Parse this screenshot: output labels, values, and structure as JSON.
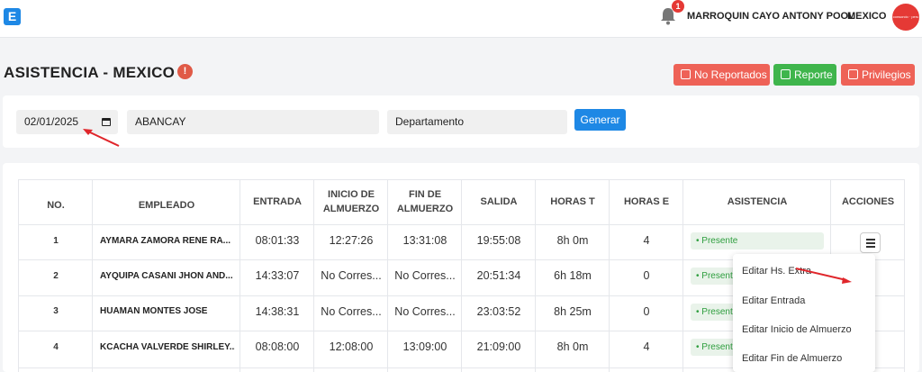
{
  "topbar": {
    "logo_letter": "E",
    "notification_count": "1",
    "user_name": "MARROQUIN CAYO ANTONY POOL",
    "country": "MEXICO",
    "avatar_text": "consorcio · peru"
  },
  "page": {
    "title": "ASISTENCIA - MEXICO",
    "info_icon": "!"
  },
  "actions": {
    "no_reportados": "No Reportados",
    "reporte": "Reporte",
    "privilegios": "Privilegios"
  },
  "filters": {
    "date_value": "02/01/2025",
    "city_value": "ABANCAY",
    "department_value": "Departamento",
    "generate_label": "Generar"
  },
  "table": {
    "headers": {
      "no": "NO.",
      "empleado": "EMPLEADO",
      "entrada": "ENTRADA",
      "inicio_1": "INICIO DE",
      "inicio_2": "ALMUERZO",
      "fin_1": "FIN DE",
      "fin_2": "ALMUERZO",
      "salida": "SALIDA",
      "horas_t": "HORAS T",
      "horas_e": "HORAS E",
      "asistencia": "ASISTENCIA",
      "acciones": "ACCIONES"
    },
    "rows": [
      {
        "no": "1",
        "empleado": "AYMARA ZAMORA RENE RA...",
        "entrada": "08:01:33",
        "inicio": "12:27:26",
        "fin": "13:31:08",
        "salida": "19:55:08",
        "horas_t": "8h 0m",
        "horas_e": "4",
        "asistencia": "• Presente"
      },
      {
        "no": "2",
        "empleado": "AYQUIPA CASANI JHON AND...",
        "entrada": "14:33:07",
        "inicio": "No Corres...",
        "fin": "No Corres...",
        "salida": "20:51:34",
        "horas_t": "6h 18m",
        "horas_e": "0",
        "asistencia": "• Presente"
      },
      {
        "no": "3",
        "empleado": "HUAMAN MONTES JOSE",
        "entrada": "14:38:31",
        "inicio": "No Corres...",
        "fin": "No Corres...",
        "salida": "23:03:52",
        "horas_t": "8h 25m",
        "horas_e": "0",
        "asistencia": "• Presente"
      },
      {
        "no": "4",
        "empleado": "KCACHA VALVERDE SHIRLEY...",
        "entrada": "08:08:00",
        "inicio": "12:08:00",
        "fin": "13:09:00",
        "salida": "21:09:00",
        "horas_t": "8h 0m",
        "horas_e": "4",
        "asistencia": "• Presente"
      }
    ]
  },
  "dropdown": {
    "items": [
      "Editar Hs. Extra",
      "Editar Entrada",
      "Editar Inicio de Almuerzo",
      "Editar Fin de Almuerzo"
    ]
  },
  "colors": {
    "primary": "#1e88e5",
    "danger": "#ee6257",
    "success": "#3fb54c",
    "annotation_arrow": "#e0262b"
  }
}
